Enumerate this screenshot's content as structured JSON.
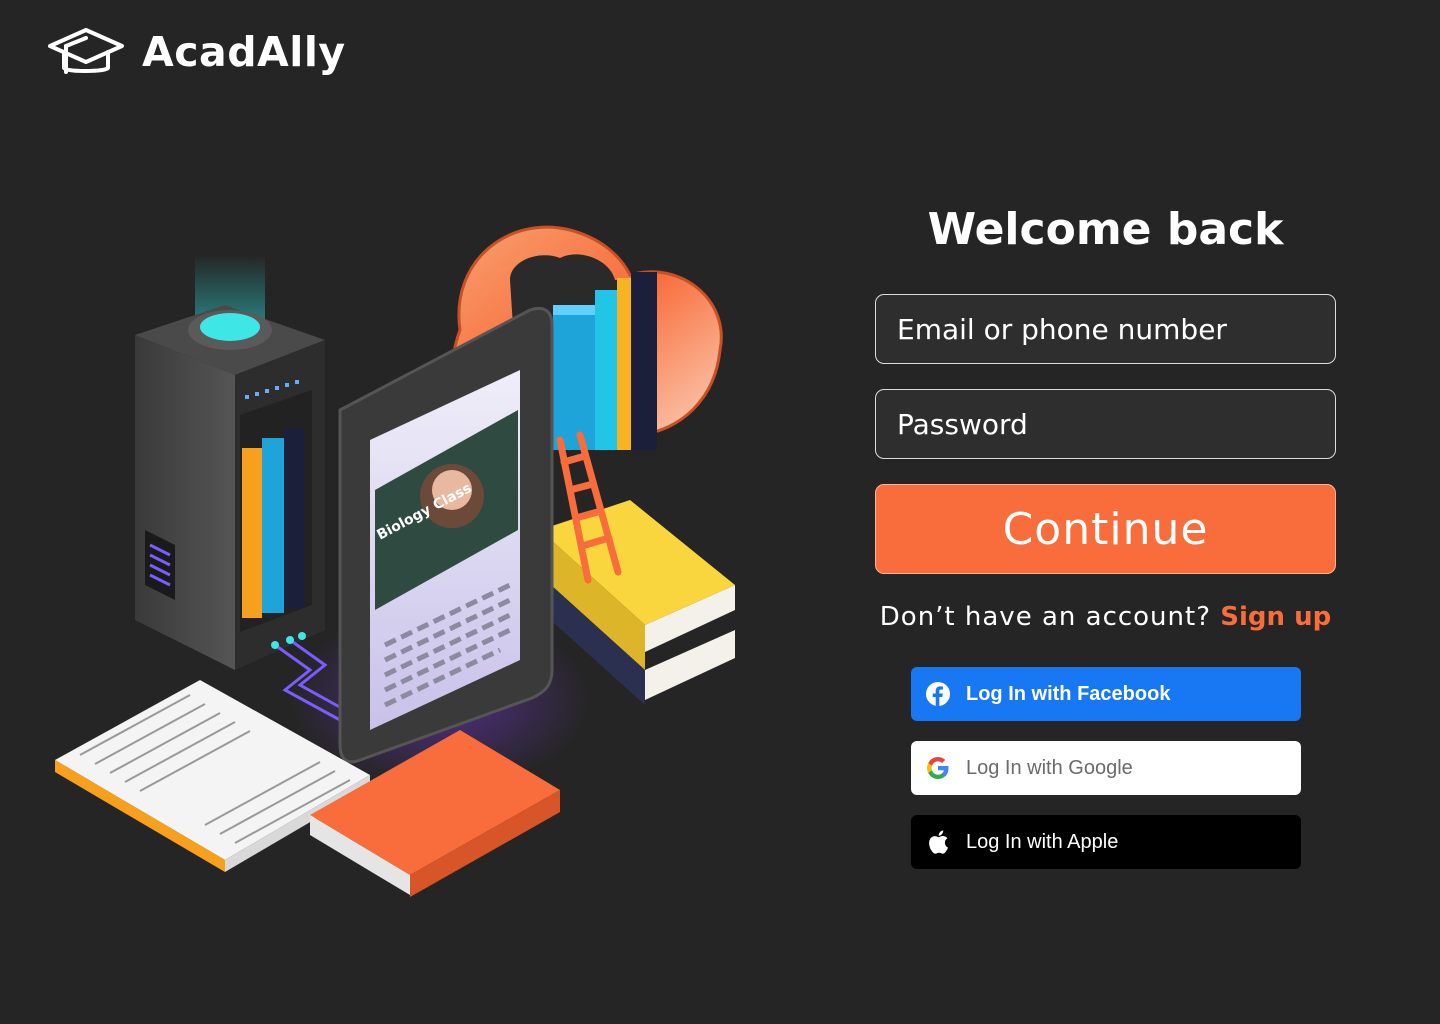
{
  "brand": {
    "name": "AcadAlly"
  },
  "illustration": {
    "screen_label": "Biology Class"
  },
  "login": {
    "title": "Welcome back",
    "email_placeholder": "Email or phone number",
    "password_placeholder": "Password",
    "continue_label": "Continue",
    "no_account_text": "Don’t have an account?",
    "signup_label": "Sign up"
  },
  "social": {
    "facebook_label": "Log In with Facebook",
    "google_label": "Log In with Google",
    "apple_label": "Log In with Apple"
  },
  "colors": {
    "background": "#252525",
    "accent": "#f86d3b",
    "facebook": "#1877f2",
    "google_button": "#ffffff",
    "apple_button": "#000000"
  },
  "icons": {
    "logo": "graduation-cap-icon",
    "facebook": "facebook-icon",
    "google": "google-icon",
    "apple": "apple-icon"
  }
}
